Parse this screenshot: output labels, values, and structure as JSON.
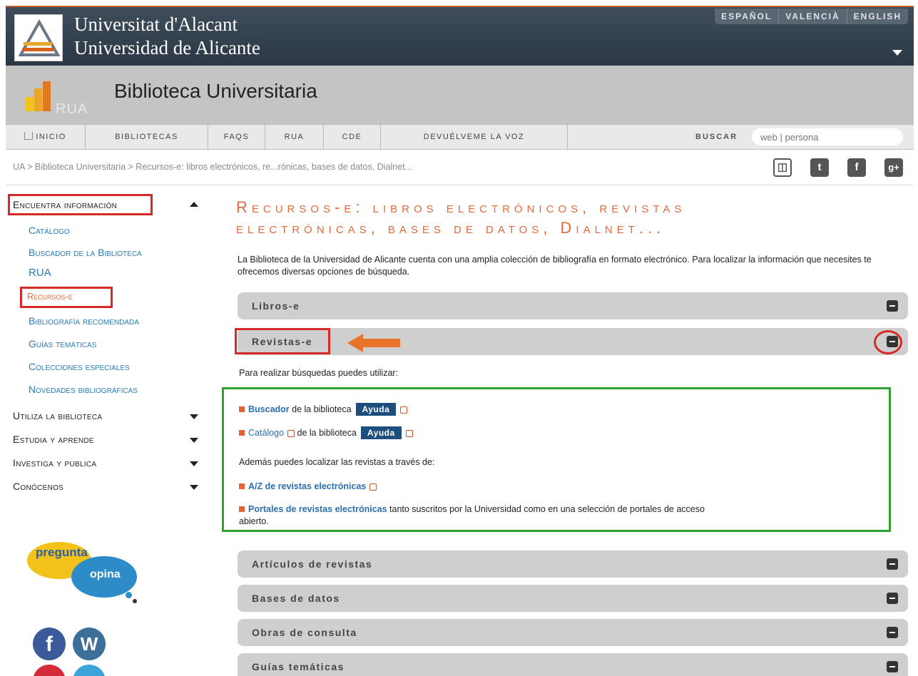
{
  "university": {
    "name_valencian": "Universitat d'Alacant",
    "name_spanish": "Universidad de Alicante",
    "languages": [
      "ESPAÑOL",
      "VALENCIÀ",
      "ENGLISH"
    ]
  },
  "library": {
    "logo_text": "RUA",
    "title": "Biblioteca Universitaria"
  },
  "nav": {
    "items": [
      "INICIO",
      "BIBLIOTECAS",
      "FAQS",
      "RUA",
      "CDE",
      "DEVUÉLVEME LA VOZ"
    ],
    "search_label": "BUSCAR",
    "search_placeholder": "web | persona"
  },
  "breadcrumb": "UA > Biblioteca Universitaria > Recursos-e: libros electrónicos, re...rónicas, bases de datos, Dialnet...",
  "social_icons": [
    "rss-icon",
    "twitter-icon",
    "facebook-icon",
    "googleplus-icon"
  ],
  "sidebar": {
    "sections": [
      {
        "label": "Encuentra información",
        "expanded": true
      },
      {
        "label": "Utiliza la biblioteca",
        "expanded": false
      },
      {
        "label": "Estudia y aprende",
        "expanded": false
      },
      {
        "label": "Investiga y publica",
        "expanded": false
      },
      {
        "label": "Conócenos",
        "expanded": false
      }
    ],
    "subitems": [
      "Catálogo",
      "Buscador de la Biblioteca",
      "RUA",
      "Recursos-e",
      "Bibliografía recomendada",
      "Guías temáticas",
      "Colecciones especiales",
      "Novedades bibliográficas"
    ],
    "bubble_top": "pregunta",
    "bubble_bottom": "opina"
  },
  "main": {
    "title_line1": "Recursos-e: libros electrónicos, revistas",
    "title_line2": "electrónicas, bases de datos, Dialnet...",
    "intro": "La Biblioteca de la Universidad de Alicante cuenta con una amplia colección de bibliografía en formato electrónico. Para localizar la información que necesites te ofrecemos diversas opciones de búsqueda.",
    "accordions": [
      "Libros-e",
      "Revistas-e",
      "Artículos de revistas",
      "Bases de datos",
      "Obras de consulta",
      "Guías temáticas"
    ],
    "revistas": {
      "lead": "Para realizar búsquedas puedes utilizar:",
      "buscador_link": "Buscador",
      "buscador_rest": " de la biblioteca",
      "catalogo_link": "Catálogo",
      "catalogo_rest": " de la biblioteca",
      "help_label": "Ayuda",
      "also": "Además puedes localizar las revistas a través de:",
      "az_link": "A/Z de revistas electrónicas",
      "portales_link": "Portales de revistas electrónicas",
      "portales_rest": " tanto suscritos por la Universidad como en una selección de portales de acceso",
      "portales_rest2": "abierto."
    }
  },
  "colors": {
    "accent_orange": "#e16a3a",
    "link_blue": "#2a7bb6",
    "highlight_red": "#d62a2a",
    "highlight_green": "#2ea12e",
    "help_button": "#1d4e7d"
  }
}
